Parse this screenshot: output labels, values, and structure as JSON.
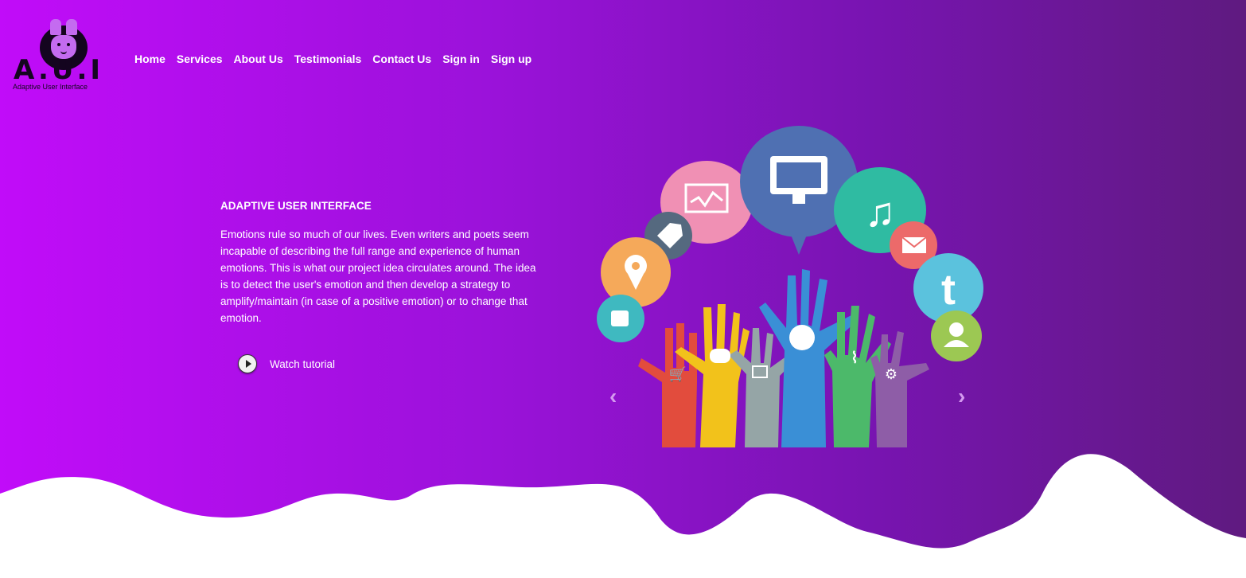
{
  "logo": {
    "wordmark": "A.U.I",
    "tagline": "Adaptive User Interface"
  },
  "nav": {
    "items": [
      {
        "label": "Home"
      },
      {
        "label": "Services"
      },
      {
        "label": "About Us"
      },
      {
        "label": "Testimonials"
      },
      {
        "label": "Contact Us"
      },
      {
        "label": "Sign in"
      },
      {
        "label": "Sign up"
      }
    ]
  },
  "hero": {
    "title": "ADAPTIVE USER INTERFACE",
    "description": "Emotions rule so much of our lives. Even writers and poets seem incapable of describing the full range and experience of human emotions. This is what our project idea circulates around. The idea is to detect the user's emotion and then develop a strategy to amplify/maintain (in case of a positive emotion) or to change that emotion.",
    "watch_label": "Watch tutorial"
  },
  "carousel": {
    "prev_symbol": "‹",
    "next_symbol": "›"
  },
  "colors": {
    "gradient_start": "#c10cf9",
    "gradient_end": "#5f1a80",
    "text": "#ffffff"
  }
}
